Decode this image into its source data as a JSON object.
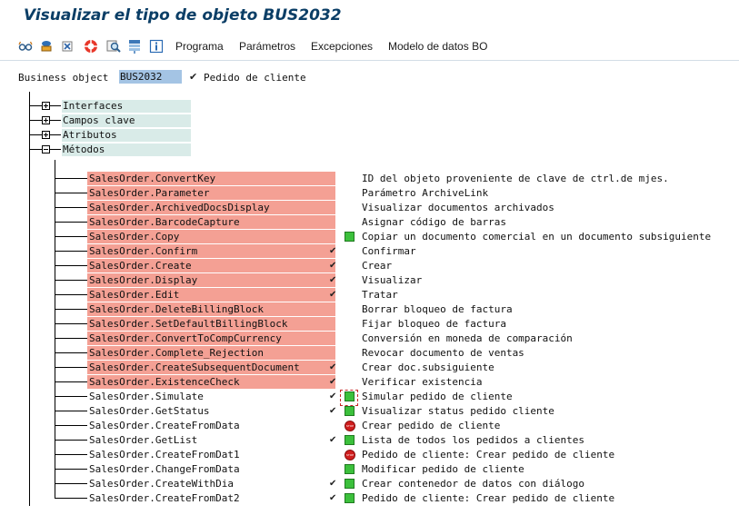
{
  "title": "Visualizar el tipo de objeto BUS2032",
  "toolbar": {
    "icons": [
      "glasses-icon",
      "display-icon",
      "stop-circle-icon",
      "help-icon",
      "search-icon",
      "structure-icon",
      "info-icon"
    ],
    "menus": [
      "Programa",
      "Parámetros",
      "Excepciones",
      "Modelo de datos BO"
    ]
  },
  "business_object": {
    "label": "Business object",
    "value": "BUS2032",
    "check": "✔",
    "description": "Pedido de cliente"
  },
  "tree": {
    "folders": [
      {
        "label": "Interfaces",
        "state": "collapsed"
      },
      {
        "label": "Campos clave",
        "state": "collapsed"
      },
      {
        "label": "Atributos",
        "state": "collapsed"
      },
      {
        "label": "Métodos",
        "state": "expanded"
      }
    ],
    "methods": [
      {
        "name": "SalesOrder.ConvertKey",
        "desc": "ID del objeto proveniente de clave de ctrl.de mjes.",
        "check": "",
        "status": "none",
        "highlight": "#f4a094"
      },
      {
        "name": "SalesOrder.Parameter",
        "desc": "Parámetro ArchiveLink",
        "check": "",
        "status": "none",
        "highlight": "#f4a094"
      },
      {
        "name": "SalesOrder.ArchivedDocsDisplay",
        "desc": "Visualizar documentos archivados",
        "check": "",
        "status": "none",
        "highlight": "#f4a094"
      },
      {
        "name": "SalesOrder.BarcodeCapture",
        "desc": "Asignar código de barras",
        "check": "",
        "status": "none",
        "highlight": "#f4a094"
      },
      {
        "name": "SalesOrder.Copy",
        "desc": "Copiar un documento comercial en un documento subsiguiente",
        "check": "",
        "status": "green",
        "highlight": "#f4a094"
      },
      {
        "name": "SalesOrder.Confirm",
        "desc": "Confirmar",
        "check": "✔",
        "status": "none",
        "highlight": "#f4a094"
      },
      {
        "name": "SalesOrder.Create",
        "desc": "Crear",
        "check": "✔",
        "status": "none",
        "highlight": "#f4a094"
      },
      {
        "name": "SalesOrder.Display",
        "desc": "Visualizar",
        "check": "✔",
        "status": "none",
        "highlight": "#f4a094"
      },
      {
        "name": "SalesOrder.Edit",
        "desc": "Tratar",
        "check": "✔",
        "status": "none",
        "highlight": "#f4a094"
      },
      {
        "name": "SalesOrder.DeleteBillingBlock",
        "desc": "Borrar bloqueo de factura",
        "check": "",
        "status": "none",
        "highlight": "#f4a094"
      },
      {
        "name": "SalesOrder.SetDefaultBillingBlock",
        "desc": "Fijar bloqueo de factura",
        "check": "",
        "status": "none",
        "highlight": "#f4a094"
      },
      {
        "name": "SalesOrder.ConvertToCompCurrency",
        "desc": "Conversión en moneda de comparación",
        "check": "",
        "status": "none",
        "highlight": "#f4a094"
      },
      {
        "name": "SalesOrder.Complete_Rejection",
        "desc": "Revocar documento de ventas",
        "check": "",
        "status": "none",
        "highlight": "#f4a094"
      },
      {
        "name": "SalesOrder.CreateSubsequentDocument",
        "desc": "Crear doc.subsiguiente",
        "check": "✔",
        "status": "none",
        "highlight": "#f4a094"
      },
      {
        "name": "SalesOrder.ExistenceCheck",
        "desc": "Verificar existencia",
        "check": "✔",
        "status": "none",
        "highlight": "#f4a094"
      },
      {
        "name": "SalesOrder.Simulate",
        "desc": "Simular pedido de cliente",
        "check": "✔",
        "status": "green",
        "highlight": ""
      },
      {
        "name": "SalesOrder.GetStatus",
        "desc": "Visualizar status pedido cliente",
        "check": "✔",
        "status": "green",
        "highlight": ""
      },
      {
        "name": "SalesOrder.CreateFromData",
        "desc": "Crear pedido de cliente",
        "check": "",
        "status": "stop",
        "highlight": ""
      },
      {
        "name": "SalesOrder.GetList",
        "desc": "Lista de todos los pedidos a clientes",
        "check": "✔",
        "status": "green",
        "highlight": ""
      },
      {
        "name": "SalesOrder.CreateFromDat1",
        "desc": "Pedido de cliente: Crear pedido de cliente",
        "check": "",
        "status": "stop",
        "highlight": ""
      },
      {
        "name": "SalesOrder.ChangeFromData",
        "desc": "Modificar pedido de cliente",
        "check": "",
        "status": "green",
        "highlight": ""
      },
      {
        "name": "SalesOrder.CreateWithDia",
        "desc": "Crear contenedor de datos con diálogo",
        "check": "✔",
        "status": "green",
        "highlight": ""
      },
      {
        "name": "SalesOrder.CreateFromDat2",
        "desc": "Pedido de cliente: Crear pedido de cliente",
        "check": "✔",
        "status": "green",
        "highlight": ""
      }
    ]
  },
  "colors": {
    "title": "#0b3e66",
    "method_highlight": "#f4a094",
    "folder_label_bg": "#d9ebe8",
    "field_bg": "#a4c4e4",
    "status_green": "#3cc03c",
    "status_stop": "#d01e1e"
  }
}
